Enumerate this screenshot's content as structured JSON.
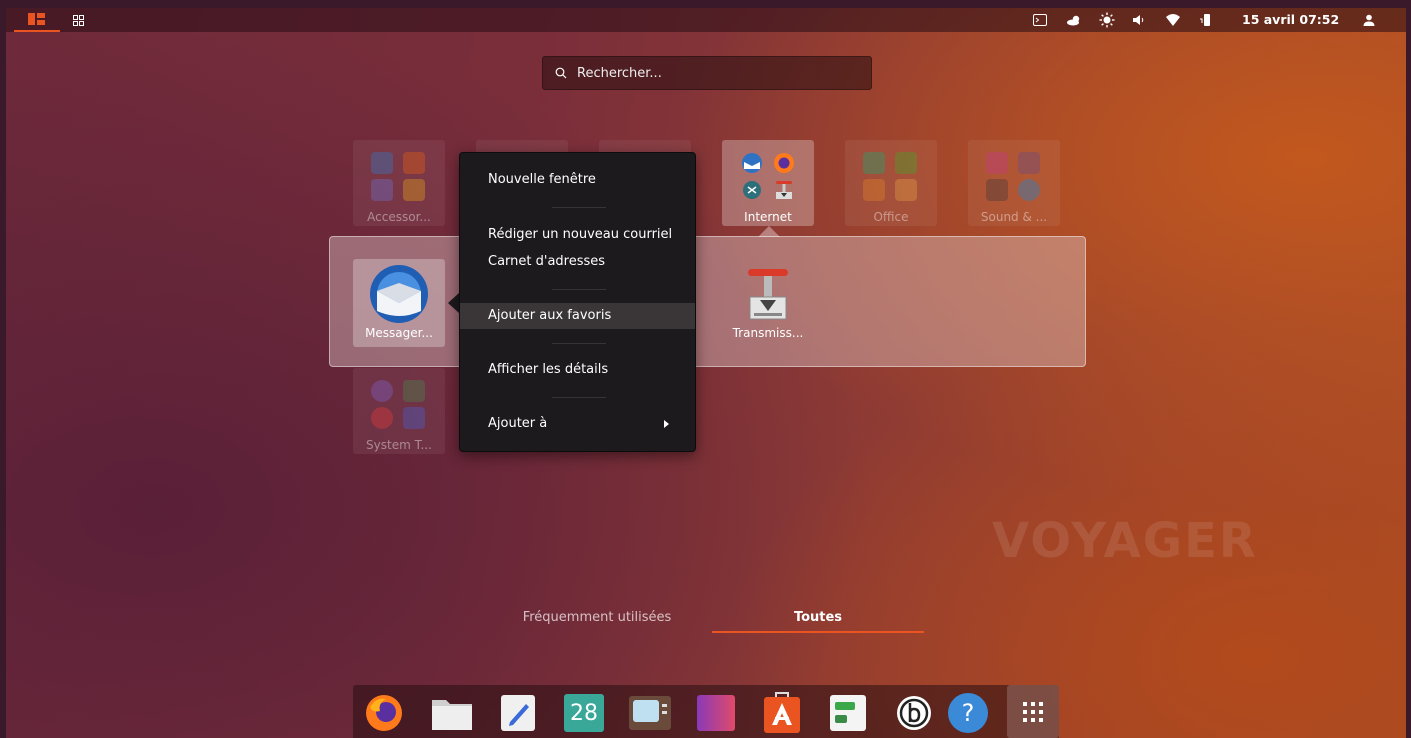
{
  "topbar": {
    "activities_icon": "ubuntu-activities-icon",
    "app_grid_icon": "grid-small-icon",
    "tray_icons": [
      "terminal-icon",
      "weather-icon",
      "brightness-icon",
      "volume-icon",
      "wifi-icon",
      "battery-icon"
    ],
    "clock": "15 avril 07:52",
    "user_icon": "user-icon"
  },
  "search": {
    "placeholder": "Rechercher..."
  },
  "folders": [
    {
      "label": "Accessor...",
      "icons": [
        "help-icon",
        "tools-icon",
        "calculator-icon",
        "colors-icon"
      ]
    },
    {
      "label": "",
      "icons": []
    },
    {
      "label": "",
      "icons": []
    },
    {
      "label": "Internet",
      "icons": [
        "thunderbird-icon",
        "firefox-icon",
        "remmina-icon",
        "transmission-icon"
      ]
    },
    {
      "label": "Office",
      "icons": [
        "calendar-icon",
        "spreadsheet-icon",
        "presentation-icon",
        "document-icon"
      ]
    },
    {
      "label": "Sound & ...",
      "icons": [
        "speaker-icon",
        "media-icon",
        "video-icon",
        "equalizer-icon"
      ]
    },
    {
      "label": "System T...",
      "icons": [
        "disk-usage-icon",
        "monitor-icon",
        "pie-icon",
        "display-icon"
      ]
    }
  ],
  "internet_folder": {
    "apps": [
      {
        "label": "Messager...",
        "icon": "thunderbird-icon"
      },
      {
        "label": "Transmiss...",
        "icon": "transmission-icon"
      }
    ]
  },
  "context_menu": {
    "items": [
      {
        "label": "Nouvelle fenêtre"
      },
      {
        "label": "Rédiger un nouveau courriel"
      },
      {
        "label": "Carnet d'adresses"
      },
      {
        "label": "Ajouter aux favoris"
      },
      {
        "label": "Afficher les détails"
      },
      {
        "label": "Ajouter à"
      }
    ]
  },
  "watermark": "VOYAGER",
  "view_tabs": {
    "frequent": "Fréquemment utilisées",
    "all": "Toutes"
  },
  "dock": {
    "items": [
      "firefox-icon",
      "files-icon",
      "text-editor-icon",
      "calendar-icon",
      "video-player-icon",
      "colors-app-icon",
      "software-center-icon",
      "system-monitor-icon",
      "bleachbit-icon",
      "help-icon",
      "show-apps-icon"
    ],
    "calendar_day": "28",
    "help_glyph": "?"
  },
  "colors": {
    "accent": "#e95420",
    "menu_bg": "#1c1a1c"
  }
}
